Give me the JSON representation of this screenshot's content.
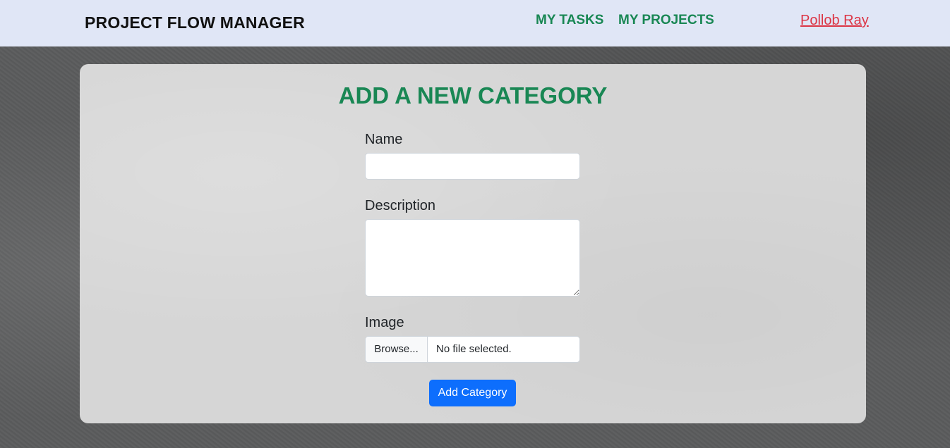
{
  "navbar": {
    "brand": "PROJECT FLOW MANAGER",
    "links": [
      {
        "label": "MY TASKS"
      },
      {
        "label": "MY PROJECTS"
      }
    ],
    "user_name": "Pollob Ray"
  },
  "form": {
    "title": "ADD A NEW CATEGORY",
    "name_label": "Name",
    "name_value": "",
    "description_label": "Description",
    "description_value": "",
    "image_label": "Image",
    "browse_label": "Browse...",
    "file_status": "No file selected.",
    "submit_label": "Add Category"
  },
  "colors": {
    "navbar_bg": "#e0e6f6",
    "accent_green": "#198754",
    "user_link_red": "#dc3545",
    "primary_button": "#0d6efd",
    "card_bg": "#d6d6d6"
  }
}
